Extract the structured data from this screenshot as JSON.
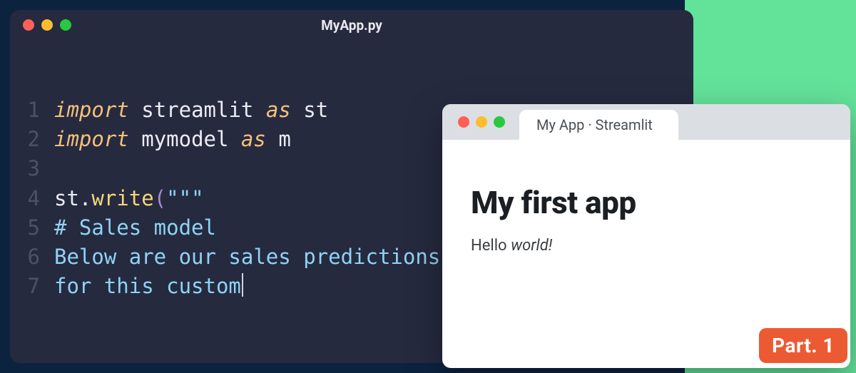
{
  "editor": {
    "filename": "MyApp.py",
    "lines": [
      {
        "n": "1",
        "tokens": [
          {
            "t": "import",
            "cls": "tok-keyword"
          },
          {
            "t": " ",
            "cls": ""
          },
          {
            "t": "streamlit",
            "cls": "tok-module"
          },
          {
            "t": " ",
            "cls": ""
          },
          {
            "t": "as",
            "cls": "tok-as"
          },
          {
            "t": " ",
            "cls": ""
          },
          {
            "t": "st",
            "cls": "tok-alias"
          }
        ]
      },
      {
        "n": "2",
        "tokens": [
          {
            "t": "import",
            "cls": "tok-keyword"
          },
          {
            "t": " ",
            "cls": ""
          },
          {
            "t": "mymodel",
            "cls": "tok-module"
          },
          {
            "t": " ",
            "cls": ""
          },
          {
            "t": "as",
            "cls": "tok-as"
          },
          {
            "t": " ",
            "cls": ""
          },
          {
            "t": "m",
            "cls": "tok-alias"
          }
        ]
      },
      {
        "n": "3",
        "tokens": []
      },
      {
        "n": "4",
        "tokens": [
          {
            "t": "st",
            "cls": "tok-obj"
          },
          {
            "t": ".",
            "cls": "tok-dot"
          },
          {
            "t": "write",
            "cls": "tok-method"
          },
          {
            "t": "(",
            "cls": "tok-paren"
          },
          {
            "t": "\"\"\"",
            "cls": "tok-string"
          }
        ]
      },
      {
        "n": "5",
        "tokens": [
          {
            "t": "# Sales model",
            "cls": "tok-string"
          }
        ]
      },
      {
        "n": "6",
        "tokens": [
          {
            "t": "Below are our sales predictions",
            "cls": "tok-string"
          }
        ]
      },
      {
        "n": "7",
        "tokens": [
          {
            "t": "for this custom",
            "cls": "tok-string"
          }
        ],
        "cursor": true
      }
    ]
  },
  "browser": {
    "tab_title": "My App · Streamlit",
    "heading": "My first app",
    "text_plain": "Hello ",
    "text_italic": "world!"
  },
  "badge": {
    "label": "Part. 1"
  },
  "colors": {
    "editor_bg": "#262a3f",
    "accent_green": "#63e29a",
    "badge_bg": "#ec5a33"
  }
}
